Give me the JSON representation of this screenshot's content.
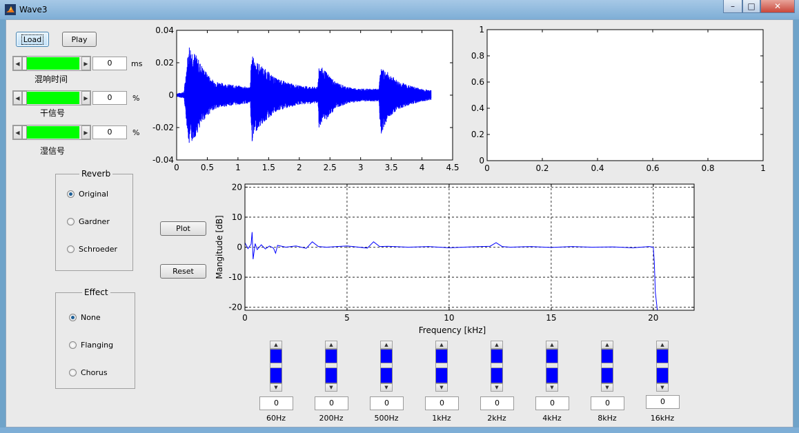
{
  "window": {
    "title": "Wave3",
    "min": "–",
    "max": "□",
    "close": "✕"
  },
  "controls": {
    "load_label": "Load",
    "play_label": "Play",
    "sliders": [
      {
        "value": "0",
        "unit": "ms",
        "label": "混响时间"
      },
      {
        "value": "0",
        "unit": "%",
        "label": "干信号"
      },
      {
        "value": "0",
        "unit": "%",
        "label": "湿信号"
      }
    ]
  },
  "reverb": {
    "title": "Reverb",
    "options": [
      "Original",
      "Gardner",
      "Schroeder"
    ],
    "selected": "Original"
  },
  "effect": {
    "title": "Effect",
    "options": [
      "None",
      "Flanging",
      "Chorus"
    ],
    "selected": "None"
  },
  "actions": {
    "plot_label": "Plot",
    "reset_label": "Reset"
  },
  "equalizer": {
    "bands": [
      {
        "label": "60Hz",
        "value": "0"
      },
      {
        "label": "200Hz",
        "value": "0"
      },
      {
        "label": "500Hz",
        "value": "0"
      },
      {
        "label": "1kHz",
        "value": "0"
      },
      {
        "label": "2kHz",
        "value": "0"
      },
      {
        "label": "4kHz",
        "value": "0"
      },
      {
        "label": "8kHz",
        "value": "0"
      },
      {
        "label": "16kHz",
        "value": "0"
      }
    ]
  },
  "chart_data": [
    {
      "type": "line",
      "series_color": "#0000ff",
      "xlim": [
        0,
        4.5
      ],
      "ylim": [
        -0.04,
        0.04
      ],
      "xticks": [
        "0",
        "0.5",
        "1",
        "1.5",
        "2",
        "2.5",
        "3",
        "3.5",
        "4",
        "4.5"
      ],
      "yticks": [
        "0.04",
        "0.02",
        "0",
        "-0.02",
        "-0.04"
      ],
      "envelope": {
        "x": [
          0,
          0.12,
          0.2,
          0.3,
          0.45,
          0.6,
          0.8,
          1.0,
          1.2,
          1.22,
          1.3,
          1.45,
          1.6,
          1.8,
          2.0,
          2.3,
          2.32,
          2.45,
          2.6,
          2.8,
          3.0,
          3.3,
          3.32,
          3.45,
          3.6,
          3.8,
          4.0,
          4.15
        ],
        "upper": [
          0.001,
          0.002,
          0.032,
          0.026,
          0.016,
          0.009,
          0.007,
          0.006,
          0.005,
          0.025,
          0.021,
          0.016,
          0.011,
          0.008,
          0.006,
          0.005,
          0.019,
          0.014,
          0.008,
          0.005,
          0.004,
          0.004,
          0.017,
          0.014,
          0.009,
          0.006,
          0.004,
          0.003
        ],
        "lower": [
          -0.001,
          -0.002,
          -0.032,
          -0.026,
          -0.015,
          -0.009,
          -0.007,
          -0.006,
          -0.005,
          -0.03,
          -0.022,
          -0.016,
          -0.011,
          -0.008,
          -0.006,
          -0.005,
          -0.02,
          -0.015,
          -0.008,
          -0.005,
          -0.004,
          -0.004,
          -0.025,
          -0.014,
          -0.009,
          -0.006,
          -0.004,
          -0.003
        ]
      }
    },
    {
      "type": "line",
      "xlim": [
        0,
        1
      ],
      "ylim": [
        0,
        1
      ],
      "xticks": [
        "0",
        "0.2",
        "0.4",
        "0.6",
        "0.8",
        "1"
      ],
      "yticks": [
        "1",
        "0.8",
        "0.6",
        "0.4",
        "0.2",
        "0"
      ],
      "series": []
    },
    {
      "type": "line",
      "series_color": "#0000ff",
      "grid": true,
      "xlabel": "Frequency [kHz]",
      "ylabel": "Mangitude [dB]",
      "xlim": [
        0,
        22
      ],
      "ylim": [
        -21,
        21
      ],
      "xticks": [
        "0",
        "5",
        "10",
        "15",
        "20"
      ],
      "yticks": [
        "20",
        "10",
        "0",
        "-10",
        "-20"
      ],
      "x": [
        0,
        0.15,
        0.3,
        0.35,
        0.4,
        0.5,
        0.6,
        0.8,
        1.0,
        1.2,
        1.4,
        1.5,
        1.6,
        2.0,
        2.5,
        3.0,
        3.3,
        3.6,
        4.0,
        5.0,
        6.0,
        6.3,
        6.6,
        7.0,
        8.0,
        9.0,
        10.0,
        11.0,
        12.0,
        12.3,
        12.6,
        13.0,
        14.0,
        15.0,
        16.0,
        17.0,
        18.0,
        19.0,
        19.8,
        20.0,
        20.05,
        20.1,
        20.2
      ],
      "y": [
        1.5,
        -0.5,
        1.0,
        5.0,
        -4.0,
        1.2,
        -0.8,
        0.8,
        -0.6,
        0.4,
        -0.3,
        -2.0,
        0.6,
        0.0,
        0.4,
        -0.4,
        1.8,
        0.2,
        0.0,
        0.4,
        -0.3,
        1.8,
        0.2,
        0.3,
        0.0,
        0.2,
        -0.2,
        0.1,
        0.3,
        1.5,
        0.2,
        0.0,
        0.2,
        -0.1,
        0.2,
        0.0,
        0.1,
        -0.2,
        0.2,
        0.0,
        -5.0,
        -15.0,
        -21.0
      ]
    }
  ]
}
